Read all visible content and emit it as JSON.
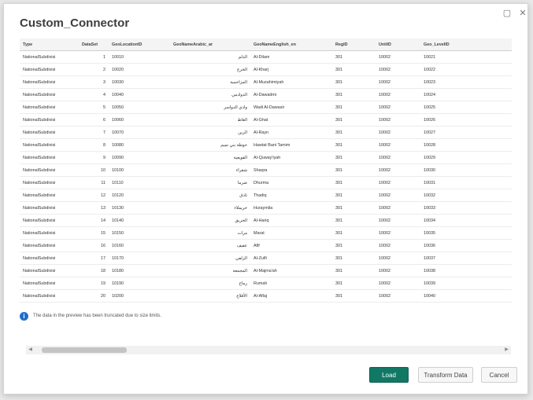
{
  "dialog": {
    "title": "Custom_Connector",
    "window_buttons": {
      "restore": "▢",
      "close": "✕"
    }
  },
  "table": {
    "columns": [
      "Type",
      "DataSet",
      "GeoLocationID",
      "GeoNameArabic_ar",
      "GeoNameEnglish_en",
      "RegID",
      "UnitID",
      "Geo_LevelID"
    ],
    "rows": [
      [
        "NationalSubdivisi",
        "1",
        "10010",
        "الدلم",
        "Al-Dilam",
        "301",
        "10002",
        "10021"
      ],
      [
        "NationalSubdivisi",
        "2",
        "10020",
        "الخرج",
        "Al-Kharj",
        "301",
        "10002",
        "10022"
      ],
      [
        "NationalSubdivisi",
        "3",
        "10030",
        "المزاحمية",
        "Al-Muzahimiyah",
        "301",
        "10002",
        "10023"
      ],
      [
        "NationalSubdivisi",
        "4",
        "10040",
        "الدوادمي",
        "Al-Dawadmi",
        "301",
        "10002",
        "10024"
      ],
      [
        "NationalSubdivisi",
        "5",
        "10050",
        "وادي الدواسر",
        "Wadi Al-Dawasir",
        "301",
        "10002",
        "10025"
      ],
      [
        "NationalSubdivisi",
        "6",
        "10060",
        "الغاط",
        "Al-Ghat",
        "301",
        "10002",
        "10026"
      ],
      [
        "NationalSubdivisi",
        "7",
        "10070",
        "الرين",
        "Al-Rayn",
        "301",
        "10002",
        "10027"
      ],
      [
        "NationalSubdivisi",
        "8",
        "10080",
        "حوطة بني تميم",
        "Hawtat Bani Tamim",
        "301",
        "10002",
        "10028"
      ],
      [
        "NationalSubdivisi",
        "9",
        "10090",
        "القويعية",
        "Al-Quway'iyah",
        "301",
        "10002",
        "10029"
      ],
      [
        "NationalSubdivisi",
        "10",
        "10100",
        "شقراء",
        "Shaqra",
        "301",
        "10002",
        "10030"
      ],
      [
        "NationalSubdivisi",
        "11",
        "10110",
        "ضرما",
        "Dhurma",
        "301",
        "10002",
        "10031"
      ],
      [
        "NationalSubdivisi",
        "12",
        "10120",
        "ثادق",
        "Thadiq",
        "301",
        "10002",
        "10032"
      ],
      [
        "NationalSubdivisi",
        "13",
        "10130",
        "حريملاء",
        "Huraymila",
        "301",
        "10002",
        "10033"
      ],
      [
        "NationalSubdivisi",
        "14",
        "10140",
        "الحريق",
        "Al-Hariq",
        "301",
        "10002",
        "10034"
      ],
      [
        "NationalSubdivisi",
        "15",
        "10150",
        "مرات",
        "Marat",
        "301",
        "10002",
        "10035"
      ],
      [
        "NationalSubdivisi",
        "16",
        "10160",
        "عفيف",
        "Afif",
        "301",
        "10002",
        "10036"
      ],
      [
        "NationalSubdivisi",
        "17",
        "10170",
        "الزلفي",
        "Al-Zulfi",
        "301",
        "10002",
        "10037"
      ],
      [
        "NationalSubdivisi",
        "18",
        "10180",
        "المجمعة",
        "Al-Majma'ah",
        "301",
        "10002",
        "10038"
      ],
      [
        "NationalSubdivisi",
        "19",
        "10190",
        "رماح",
        "Rumah",
        "301",
        "10002",
        "10039"
      ],
      [
        "NationalSubdivisi",
        "20",
        "10200",
        "الأفلاج",
        "Al-Aflaj",
        "301",
        "10002",
        "10040"
      ]
    ]
  },
  "notice": {
    "text": "The data in the preview has been truncated due to size limits."
  },
  "scrollbar": {
    "left_arrow": "◀",
    "right_arrow": "▶"
  },
  "buttons": {
    "load": "Load",
    "transform": "Transform Data",
    "cancel": "Cancel"
  },
  "colors": {
    "primary_button": "#117865",
    "info_icon": "#1e6fc6"
  }
}
